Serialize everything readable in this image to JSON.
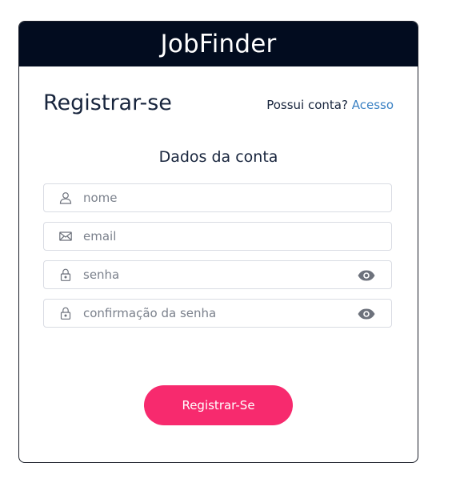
{
  "brand": "JobFinder",
  "page_title": "Registrar-se",
  "login_prompt": {
    "question": "Possui conta?",
    "link_label": "Acesso"
  },
  "section_title": "Dados da conta",
  "fields": {
    "name": {
      "placeholder": "nome",
      "icon": "user-icon"
    },
    "email": {
      "placeholder": "email",
      "icon": "envelope-icon"
    },
    "password": {
      "placeholder": "senha",
      "icon": "lock-icon",
      "toggle_icon": "eye-icon"
    },
    "password_confirm": {
      "placeholder": "confirmação da senha",
      "icon": "lock-icon",
      "toggle_icon": "eye-icon"
    }
  },
  "submit_label": "Registrar-Se",
  "colors": {
    "header_bg": "#020c1f",
    "accent": "#f72a6e",
    "link": "#3b82c4",
    "text": "#18253d"
  }
}
